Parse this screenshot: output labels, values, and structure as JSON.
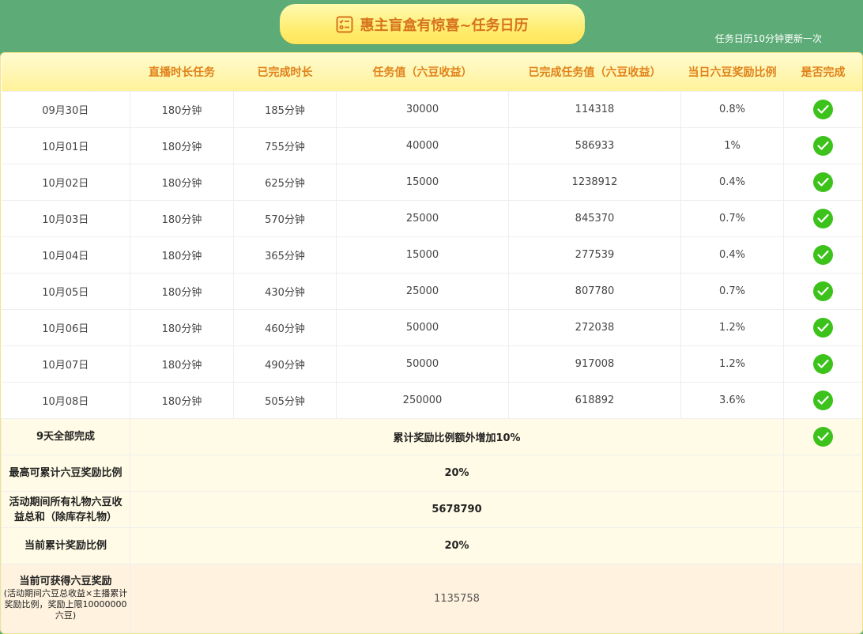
{
  "header": {
    "title": "惠主盲盒有惊喜~任务日历",
    "update_note": "任务日历10分钟更新一次"
  },
  "table": {
    "columns": [
      "",
      "直播时长任务",
      "已完成时长",
      "任务值（六豆收益）",
      "已完成任务值（六豆收益）",
      "当日六豆奖励比例",
      "是否完成"
    ],
    "rows": [
      {
        "date": "09月30日",
        "task": "180分钟",
        "done": "185分钟",
        "target": "30000",
        "achieved": "114318",
        "ratio": "0.8%",
        "complete": true
      },
      {
        "date": "10月01日",
        "task": "180分钟",
        "done": "755分钟",
        "target": "40000",
        "achieved": "586933",
        "ratio": "1%",
        "complete": true
      },
      {
        "date": "10月02日",
        "task": "180分钟",
        "done": "625分钟",
        "target": "15000",
        "achieved": "1238912",
        "ratio": "0.4%",
        "complete": true
      },
      {
        "date": "10月03日",
        "task": "180分钟",
        "done": "570分钟",
        "target": "25000",
        "achieved": "845370",
        "ratio": "0.7%",
        "complete": true
      },
      {
        "date": "10月04日",
        "task": "180分钟",
        "done": "365分钟",
        "target": "15000",
        "achieved": "277539",
        "ratio": "0.4%",
        "complete": true
      },
      {
        "date": "10月05日",
        "task": "180分钟",
        "done": "430分钟",
        "target": "25000",
        "achieved": "807780",
        "ratio": "0.7%",
        "complete": true
      },
      {
        "date": "10月06日",
        "task": "180分钟",
        "done": "460分钟",
        "target": "50000",
        "achieved": "272038",
        "ratio": "1.2%",
        "complete": true
      },
      {
        "date": "10月07日",
        "task": "180分钟",
        "done": "490分钟",
        "target": "50000",
        "achieved": "917008",
        "ratio": "1.2%",
        "complete": true
      },
      {
        "date": "10月08日",
        "task": "180分钟",
        "done": "505分钟",
        "target": "250000",
        "achieved": "618892",
        "ratio": "3.6%",
        "complete": true
      }
    ]
  },
  "summary": {
    "all_complete": {
      "label": "9天全部完成",
      "value": "累计奖励比例额外增加10%",
      "complete": true
    },
    "max_ratio": {
      "label": "最高可累计六豆奖励比例",
      "value": "20%"
    },
    "total_income": {
      "label": "活动期间所有礼物六豆收益总和（除库存礼物）",
      "value": "5678790"
    },
    "current_ratio": {
      "label": "当前累计奖励比例",
      "value": "20%"
    },
    "reward": {
      "label": "当前可获得六豆奖励",
      "note": "(活动期间六豆总收益×主播累计奖励比例，奖励上限10000000六豆)",
      "value": "1135758"
    }
  }
}
